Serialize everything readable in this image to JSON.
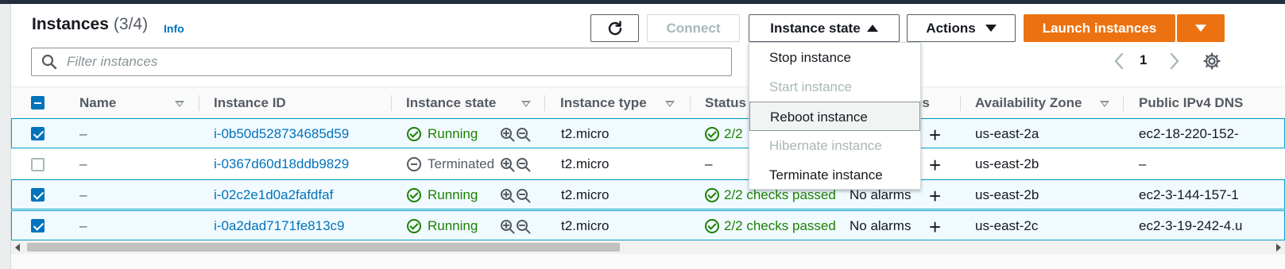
{
  "header": {
    "title": "Instances",
    "count": "(3/4)",
    "info_link": "Info"
  },
  "toolbar": {
    "refresh_icon": "refresh-icon",
    "connect_label": "Connect",
    "instance_state_label": "Instance state",
    "actions_label": "Actions",
    "launch_label": "Launch instances"
  },
  "filter": {
    "placeholder": "Filter instances",
    "value": ""
  },
  "pagination": {
    "current_page": "1"
  },
  "columns": [
    "Name",
    "Instance ID",
    "Instance state",
    "Instance type",
    "Status",
    "us",
    "Availability Zone",
    "Public IPv4 DNS"
  ],
  "rows": [
    {
      "selected": true,
      "name": "–",
      "instance_id": "i-0b50d528734685d59",
      "state": "Running",
      "type": "t2.micro",
      "status": "2/2",
      "alarm": "",
      "zone": "us-east-2a",
      "dns": "ec2-18-220-152-"
    },
    {
      "selected": false,
      "name": "–",
      "instance_id": "i-0367d60d18ddb9829",
      "state": "Terminated",
      "type": "t2.micro",
      "status": "–",
      "alarm": "",
      "zone": "us-east-2b",
      "dns": "–"
    },
    {
      "selected": true,
      "name": "–",
      "instance_id": "i-02c2e1d0a2fafdfaf",
      "state": "Running",
      "type": "t2.micro",
      "status": "2/2 checks passed",
      "alarm": "No alarms",
      "zone": "us-east-2b",
      "dns": "ec2-3-144-157-1"
    },
    {
      "selected": true,
      "name": "–",
      "instance_id": "i-0a2dad7171fe813c9",
      "state": "Running",
      "type": "t2.micro",
      "status": "2/2 checks passed",
      "alarm": "No alarms",
      "zone": "us-east-2c",
      "dns": "ec2-3-19-242-4.u"
    }
  ],
  "instance_state_menu": {
    "items": [
      {
        "label": "Stop instance",
        "disabled": false
      },
      {
        "label": "Start instance",
        "disabled": true
      },
      {
        "label": "Reboot instance",
        "disabled": false,
        "highlighted": true
      },
      {
        "label": "Hibernate instance",
        "disabled": true
      },
      {
        "label": "Terminate instance",
        "disabled": false
      }
    ]
  },
  "colors": {
    "accent": "#0073bb",
    "brand_orange": "#ec7211",
    "running_green": "#1d8102",
    "selected_row_bg": "#f1faff",
    "selected_row_border": "#00a1c9"
  }
}
